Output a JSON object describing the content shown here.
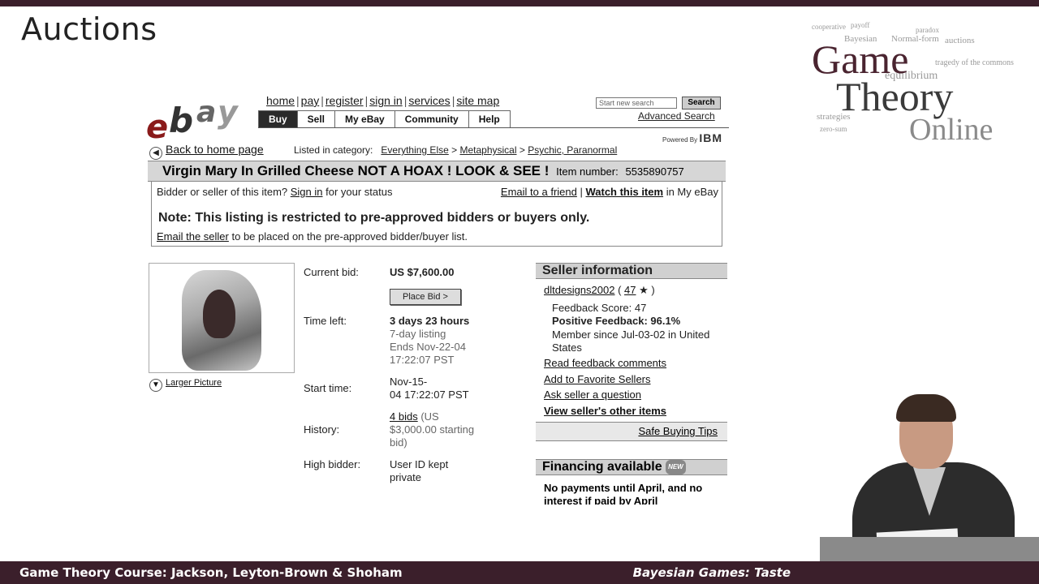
{
  "slide": {
    "title": "Auctions",
    "footer_left": "Game Theory Course: Jackson, Leyton-Brown & Shoham",
    "footer_right": "Bayesian Games: Taste",
    "colors": {
      "bar": "#3b1f2b"
    }
  },
  "logo": {
    "line1": "Game",
    "line2": "Theory",
    "line3": "Online",
    "cloud_words": [
      "cooperative",
      "payoff",
      "Bayesian",
      "Normal-form",
      "auctions",
      "tragedy of the commons",
      "equilibrium",
      "strategies",
      "zero-sum",
      "paradox"
    ]
  },
  "ebay": {
    "logo_letters": [
      "e",
      "b",
      "a",
      "y"
    ],
    "top_links": [
      "home",
      "pay",
      "register",
      "sign in",
      "services",
      "site map"
    ],
    "tabs": [
      "Buy",
      "Sell",
      "My eBay",
      "Community",
      "Help"
    ],
    "active_tab": "Buy",
    "search_placeholder": "Start new search",
    "search_button": "Search",
    "advanced_search": "Advanced Search",
    "powered_by": "Powered By",
    "powered_brand": "IBM",
    "back_link": "Back to home page",
    "category_label": "Listed in category:",
    "categories": [
      "Everything Else",
      "Metaphysical",
      "Psychic, Paranormal"
    ],
    "category_sep": ">",
    "item_title": "Virgin Mary In Grilled Cheese NOT A HOAX ! LOOK & SEE !",
    "item_number_label": "Item number:",
    "item_number": "5535890757",
    "notice": {
      "status_prefix": "Bidder or seller of this item?",
      "sign_in": "Sign in",
      "status_suffix": "for your status",
      "email_friend": "Email to a friend",
      "watch_item": "Watch this item",
      "watch_suffix": "in My eBay",
      "restriction": "Note: This listing is restricted to pre-approved bidders or buyers only.",
      "email_seller": "Email the seller",
      "email_seller_suffix": "to be placed on the pre-approved bidder/buyer list."
    },
    "larger_picture": "Larger Picture",
    "details": {
      "current_bid_label": "Current bid:",
      "current_bid": "US $7,600.00",
      "place_bid": "Place Bid >",
      "time_left_label": "Time left:",
      "time_left": "3 days 23 hours",
      "listing_length": "7-day listing",
      "ends": "Ends Nov-22-04",
      "ends_time": "17:22:07 PST",
      "start_time_label": "Start time:",
      "start_time_1": "Nov-15-",
      "start_time_2": "04 17:22:07 PST",
      "history_label": "History:",
      "bids_link": "4 bids",
      "history_note_1": "(US",
      "history_note_2": "$3,000.00 starting",
      "history_note_3": "bid)",
      "high_bidder_label": "High bidder:",
      "high_bidder_1": "User ID kept",
      "high_bidder_2": "private"
    },
    "seller": {
      "header": "Seller information",
      "user_id": "dltdesigns2002",
      "feedback_count": "47",
      "feedback_score": "Feedback Score: 47",
      "positive": "Positive Feedback: 96.1%",
      "member_since_1": "Member since Jul-03-02 in United",
      "member_since_2": "States",
      "links": [
        "Read feedback comments",
        "Add to Favorite Sellers",
        "Ask seller a question"
      ],
      "other_items": "View seller's other items",
      "safe_tips": "Safe Buying Tips"
    },
    "financing": {
      "header": "Financing available",
      "new_tag": "NEW",
      "text_1": "No payments until April, and no",
      "text_2": "interest if paid by April"
    }
  }
}
